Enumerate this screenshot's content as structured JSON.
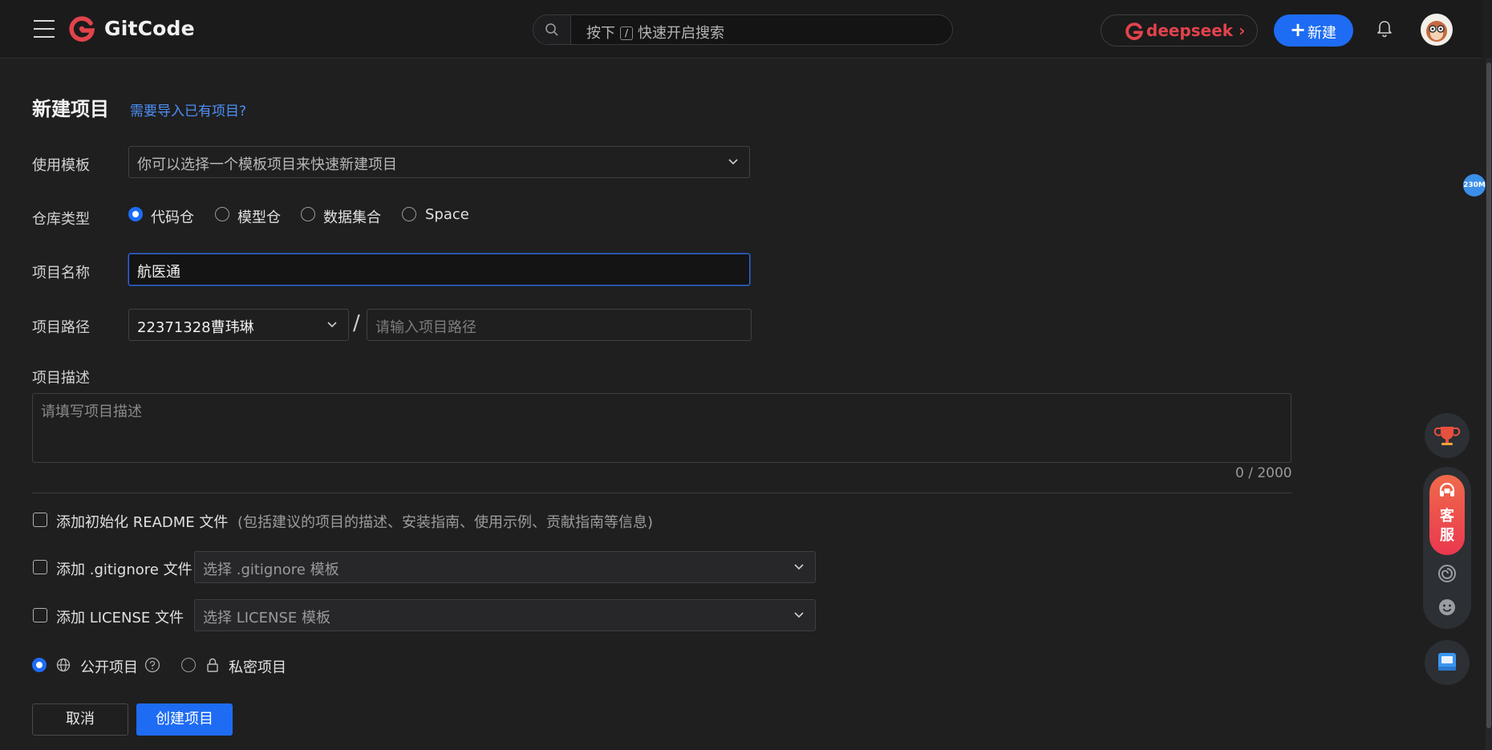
{
  "header": {
    "logo_text": "GitCode",
    "search": {
      "prefix": "按下",
      "key": "/",
      "suffix": "快速开启搜索"
    },
    "deepseek_label": "deepseek",
    "deepseek_arrow": "›",
    "new_button": "新建",
    "new_plus": "+"
  },
  "form": {
    "title": "新建项目",
    "import_link": "需要导入已有项目?",
    "template": {
      "label": "使用模板",
      "value": "你可以选择一个模板项目来快速新建项目"
    },
    "repo_type": {
      "label": "仓库类型",
      "options": [
        "代码仓",
        "模型仓",
        "数据集合",
        "Space"
      ],
      "selected": "代码仓"
    },
    "project_name": {
      "label": "项目名称",
      "value": "航医通"
    },
    "project_path": {
      "label": "项目路径",
      "namespace": "22371328曹玮琳",
      "separator": "/",
      "placeholder": "请输入项目路径"
    },
    "description": {
      "label": "项目描述",
      "placeholder": "请填写项目描述",
      "counter": "0 / 2000"
    },
    "readme": {
      "label": "添加初始化 README 文件",
      "hint": "(包括建议的项目的描述、安装指南、使用示例、贡献指南等信息)",
      "checked": false
    },
    "gitignore": {
      "label": "添加 .gitignore 文件",
      "select_placeholder": "选择 .gitignore 模板",
      "checked": false
    },
    "license": {
      "label": "添加 LICENSE 文件",
      "select_placeholder": "选择 LICENSE 模板",
      "checked": false
    },
    "visibility": {
      "public": "公开项目",
      "private": "私密项目",
      "selected": "公开项目"
    },
    "cancel_button": "取消",
    "create_button": "创建项目"
  },
  "side": {
    "memory_badge": "230M",
    "kefu_label": "客服"
  },
  "colors": {
    "accent": "#1e6cf4",
    "link": "#4e8ff5",
    "brand_red": "#e2434b",
    "background": "#1f1f20"
  }
}
